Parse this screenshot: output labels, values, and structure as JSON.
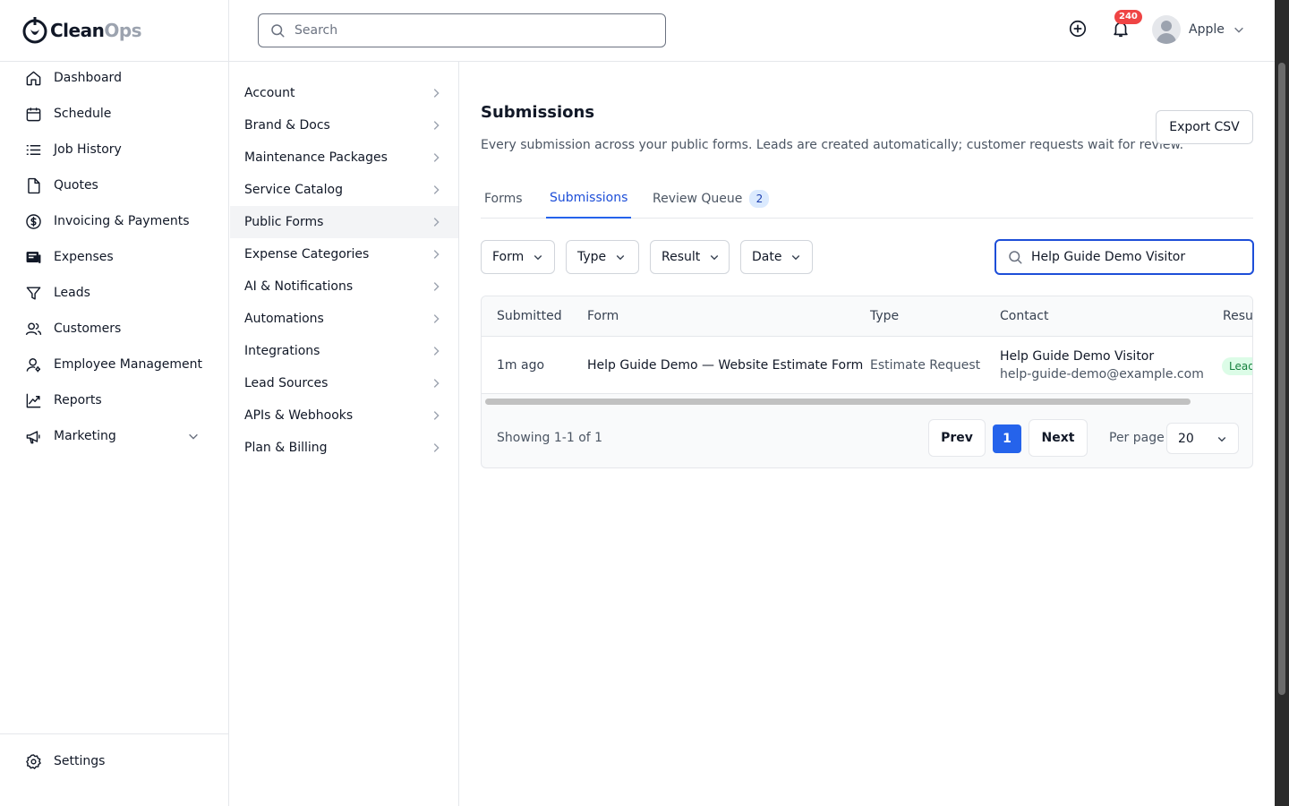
{
  "app": {
    "logo_part1": "Clean",
    "logo_part2": "Ops"
  },
  "sidebar": {
    "items": [
      {
        "label": "Dashboard",
        "icon": "home-icon"
      },
      {
        "label": "Schedule",
        "icon": "calendar-icon"
      },
      {
        "label": "Job History",
        "icon": "list-icon"
      },
      {
        "label": "Quotes",
        "icon": "document-icon"
      },
      {
        "label": "Invoicing & Payments",
        "icon": "dollar-circle-icon"
      },
      {
        "label": "Expenses",
        "icon": "receipt-icon"
      },
      {
        "label": "Leads",
        "icon": "filter-icon"
      },
      {
        "label": "Customers",
        "icon": "users-icon"
      },
      {
        "label": "Employee Management",
        "icon": "user-cog-icon"
      },
      {
        "label": "Reports",
        "icon": "chart-line-icon"
      },
      {
        "label": "Marketing",
        "icon": "megaphone-icon"
      }
    ],
    "settings_label": "Settings"
  },
  "topbar": {
    "search_placeholder": "Search",
    "notification_count": "240",
    "user_name": "Apple"
  },
  "submenu": {
    "items": [
      "Account",
      "Brand & Docs",
      "Maintenance Packages",
      "Service Catalog",
      "Public Forms",
      "Expense Categories",
      "AI & Notifications",
      "Automations",
      "Integrations",
      "Lead Sources",
      "APIs & Webhooks",
      "Plan & Billing"
    ],
    "active": "Public Forms"
  },
  "main": {
    "title": "Submissions",
    "description": "Every submission across your public forms. Leads are created automatically; customer requests wait for review.",
    "export_label": "Export CSV",
    "tabs": [
      {
        "label": "Forms"
      },
      {
        "label": "Submissions",
        "active": true
      },
      {
        "label": "Review Queue",
        "count": "2"
      }
    ],
    "filters": [
      "Form",
      "Type",
      "Result",
      "Date"
    ],
    "search_value": "Help Guide Demo Visitor",
    "table": {
      "columns": [
        "Submitted",
        "Form",
        "Type",
        "Contact",
        "Result"
      ],
      "rows": [
        {
          "submitted": "1m ago",
          "form": "Help Guide Demo — Website Estimate Form",
          "type": "Estimate Request",
          "contact_name": "Help Guide Demo Visitor",
          "contact_email": "help-guide-demo@example.com",
          "result": "Lead created"
        }
      ]
    },
    "pagination": {
      "showing": "Showing 1-1 of 1",
      "prev": "Prev",
      "page": "1",
      "next": "Next",
      "per_page_label": "Per page",
      "per_page_value": "20"
    }
  },
  "colors": {
    "accent": "#2563eb",
    "badge": "#ef4444",
    "lead_pill_bg": "#dcfce7",
    "lead_pill_text": "#15803d"
  }
}
